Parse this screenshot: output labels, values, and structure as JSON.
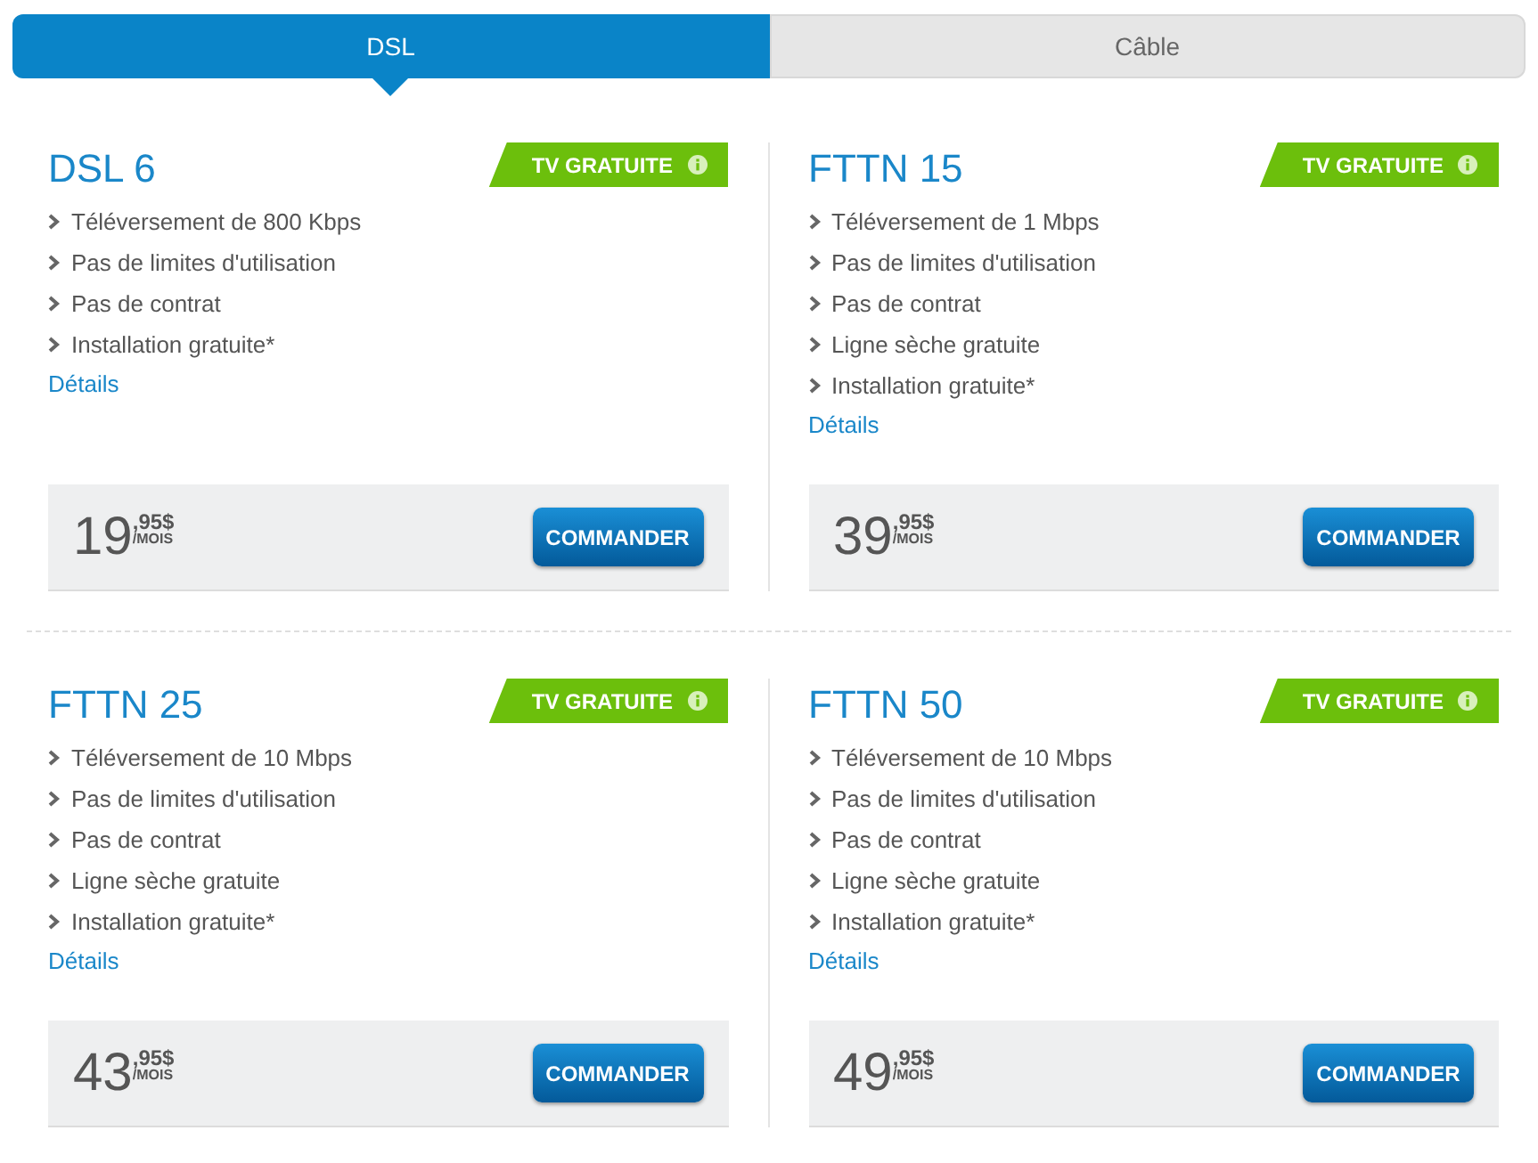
{
  "tabs": [
    {
      "label": "DSL",
      "selected": true
    },
    {
      "label": "Câble",
      "selected": false
    }
  ],
  "plans": [
    {
      "name": "DSL 6",
      "badge": "TV GRATUITE",
      "features": [
        "Téléversement de 800 Kbps",
        "Pas de limites d'utilisation",
        "Pas de contrat",
        "Installation gratuite*"
      ],
      "details": "Détails",
      "price": {
        "whole": "19",
        "cents": ",95$",
        "period": "/MOIS"
      },
      "button": "COMMANDER"
    },
    {
      "name": "FTTN 15",
      "badge": "TV GRATUITE",
      "features": [
        "Téléversement de 1 Mbps",
        "Pas de limites d'utilisation",
        "Pas de contrat",
        "Ligne sèche gratuite",
        "Installation gratuite*"
      ],
      "details": "Détails",
      "price": {
        "whole": "39",
        "cents": ",95$",
        "period": "/MOIS"
      },
      "button": "COMMANDER"
    },
    {
      "name": "FTTN 25",
      "badge": "TV GRATUITE",
      "features": [
        "Téléversement de 10 Mbps",
        "Pas de limites d'utilisation",
        "Pas de contrat",
        "Ligne sèche gratuite",
        "Installation gratuite*"
      ],
      "details": "Détails",
      "price": {
        "whole": "43",
        "cents": ",95$",
        "period": "/MOIS"
      },
      "button": "COMMANDER"
    },
    {
      "name": "FTTN 50",
      "badge": "TV GRATUITE",
      "features": [
        "Téléversement de 10 Mbps",
        "Pas de limites d'utilisation",
        "Pas de contrat",
        "Ligne sèche gratuite",
        "Installation gratuite*"
      ],
      "details": "Détails",
      "price": {
        "whole": "49",
        "cents": ",95$",
        "period": "/MOIS"
      },
      "button": "COMMANDER"
    }
  ]
}
